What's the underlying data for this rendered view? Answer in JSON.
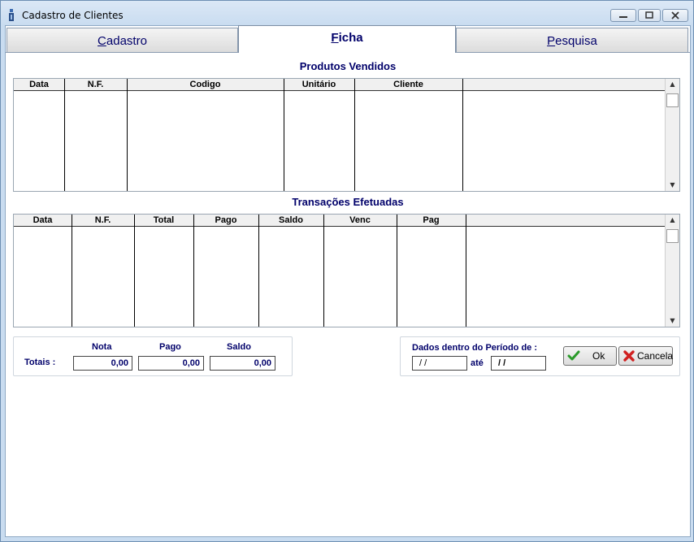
{
  "window": {
    "title": "Cadastro de Clientes"
  },
  "tabs": [
    {
      "label": "Cadastro",
      "mnemonic": "C",
      "rest": "adastro"
    },
    {
      "label": "Ficha",
      "mnemonic": "F",
      "rest": "icha"
    },
    {
      "label": "Pesquisa",
      "mnemonic": "P",
      "rest": "esquisa"
    }
  ],
  "produtos": {
    "title": "Produtos Vendidos",
    "columns": [
      "Data",
      "N.F.",
      "Codigo",
      "Unitário",
      "Cliente"
    ]
  },
  "transacoes": {
    "title": "Transações Efetuadas",
    "columns": [
      "Data",
      "N.F.",
      "Total",
      "Pago",
      "Saldo",
      "Venc",
      "Pag"
    ]
  },
  "totais": {
    "label": "Totais :",
    "nota_label": "Nota",
    "pago_label": "Pago",
    "saldo_label": "Saldo",
    "nota_value": "0,00",
    "pago_value": "0,00",
    "saldo_value": "0,00"
  },
  "periodo": {
    "label": "Dados dentro do Período de :",
    "ate_label": "até",
    "from_value": " /  /",
    "to_value": "/  /"
  },
  "buttons": {
    "ok": "Ok",
    "cancel": "Cancela"
  },
  "icons": {
    "app": "app-icon",
    "ok": "check-icon",
    "cancel": "x-icon"
  },
  "colors": {
    "label_blue": "#00006a",
    "ok_green": "#2a9a2a",
    "cancel_red": "#d02020"
  }
}
